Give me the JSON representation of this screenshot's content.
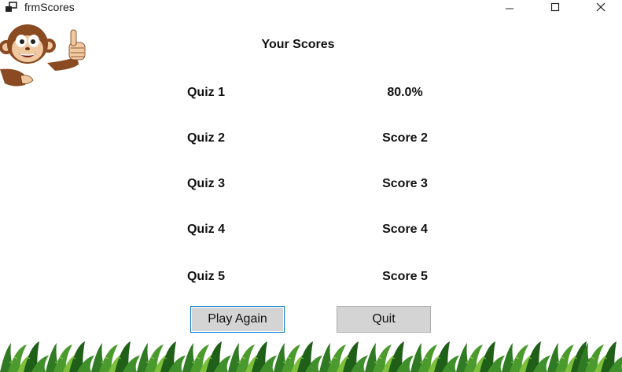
{
  "window": {
    "title": "frmScores",
    "icon": "app-window-icon",
    "controls": [
      "minimize-icon",
      "maximize-icon",
      "close-icon"
    ]
  },
  "form": {
    "heading": "Your Scores",
    "rows": [
      {
        "quiz": "Quiz 1",
        "score": "80.0%"
      },
      {
        "quiz": "Quiz 2",
        "score": "Score 2"
      },
      {
        "quiz": "Quiz 3",
        "score": "Score 3"
      },
      {
        "quiz": "Quiz 4",
        "score": "Score 4"
      },
      {
        "quiz": "Quiz 5",
        "score": "Score 5"
      }
    ],
    "buttons": {
      "play_again": "Play Again",
      "quit": "Quit"
    }
  },
  "decor": {
    "mascot": "monkey-thumbs-up",
    "footer": "jungle-leaves",
    "colors": {
      "button_bg": "#d4d4d4",
      "focus_border": "#0078d4",
      "leaf_green": "#3f8f2a"
    }
  }
}
